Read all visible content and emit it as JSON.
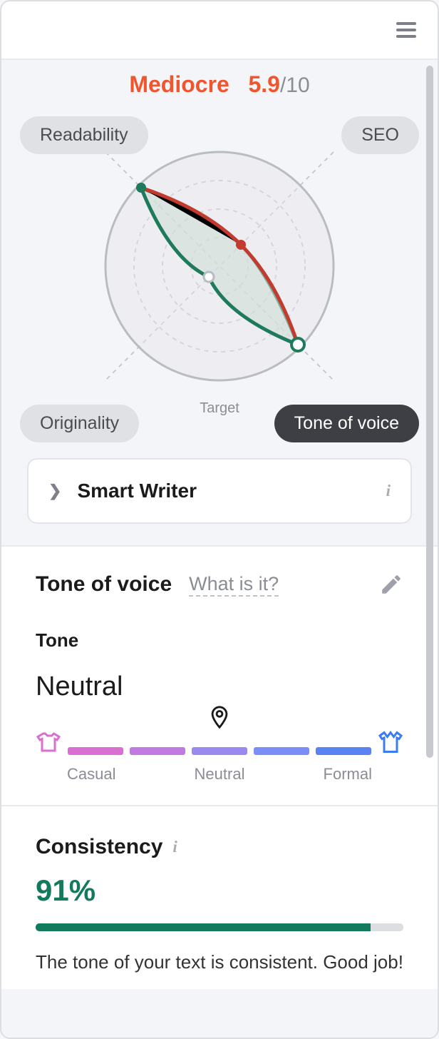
{
  "score": {
    "word": "Mediocre",
    "value": "5.9",
    "max": "/10"
  },
  "radar": {
    "labels": {
      "tl": "Readability",
      "tr": "SEO",
      "bl": "Originality",
      "br": "Tone of voice",
      "active": "br"
    },
    "target_label": "Target"
  },
  "chart_data": {
    "type": "radar",
    "axes": [
      "Readability",
      "SEO",
      "Originality",
      "Tone of voice"
    ],
    "values": [
      9,
      2,
      1,
      9
    ],
    "range": [
      0,
      10
    ],
    "title": "Content score radar",
    "target_shape": "circle"
  },
  "smart_writer": {
    "label": "Smart Writer"
  },
  "tov": {
    "title": "Tone of voice",
    "what_link": "What is it?",
    "tone_label": "Tone",
    "tone_value": "Neutral",
    "slider_labels": {
      "left": "Casual",
      "mid": "Neutral",
      "right": "Formal"
    },
    "slider_colors": [
      "#d96fd0",
      "#c17ae0",
      "#9a89ee",
      "#7a8ef5",
      "#5b82f2"
    ]
  },
  "consistency": {
    "title": "Consistency",
    "percent_text": "91%",
    "percent_value": 91,
    "message": "The tone of your text is consistent. Good job!"
  }
}
